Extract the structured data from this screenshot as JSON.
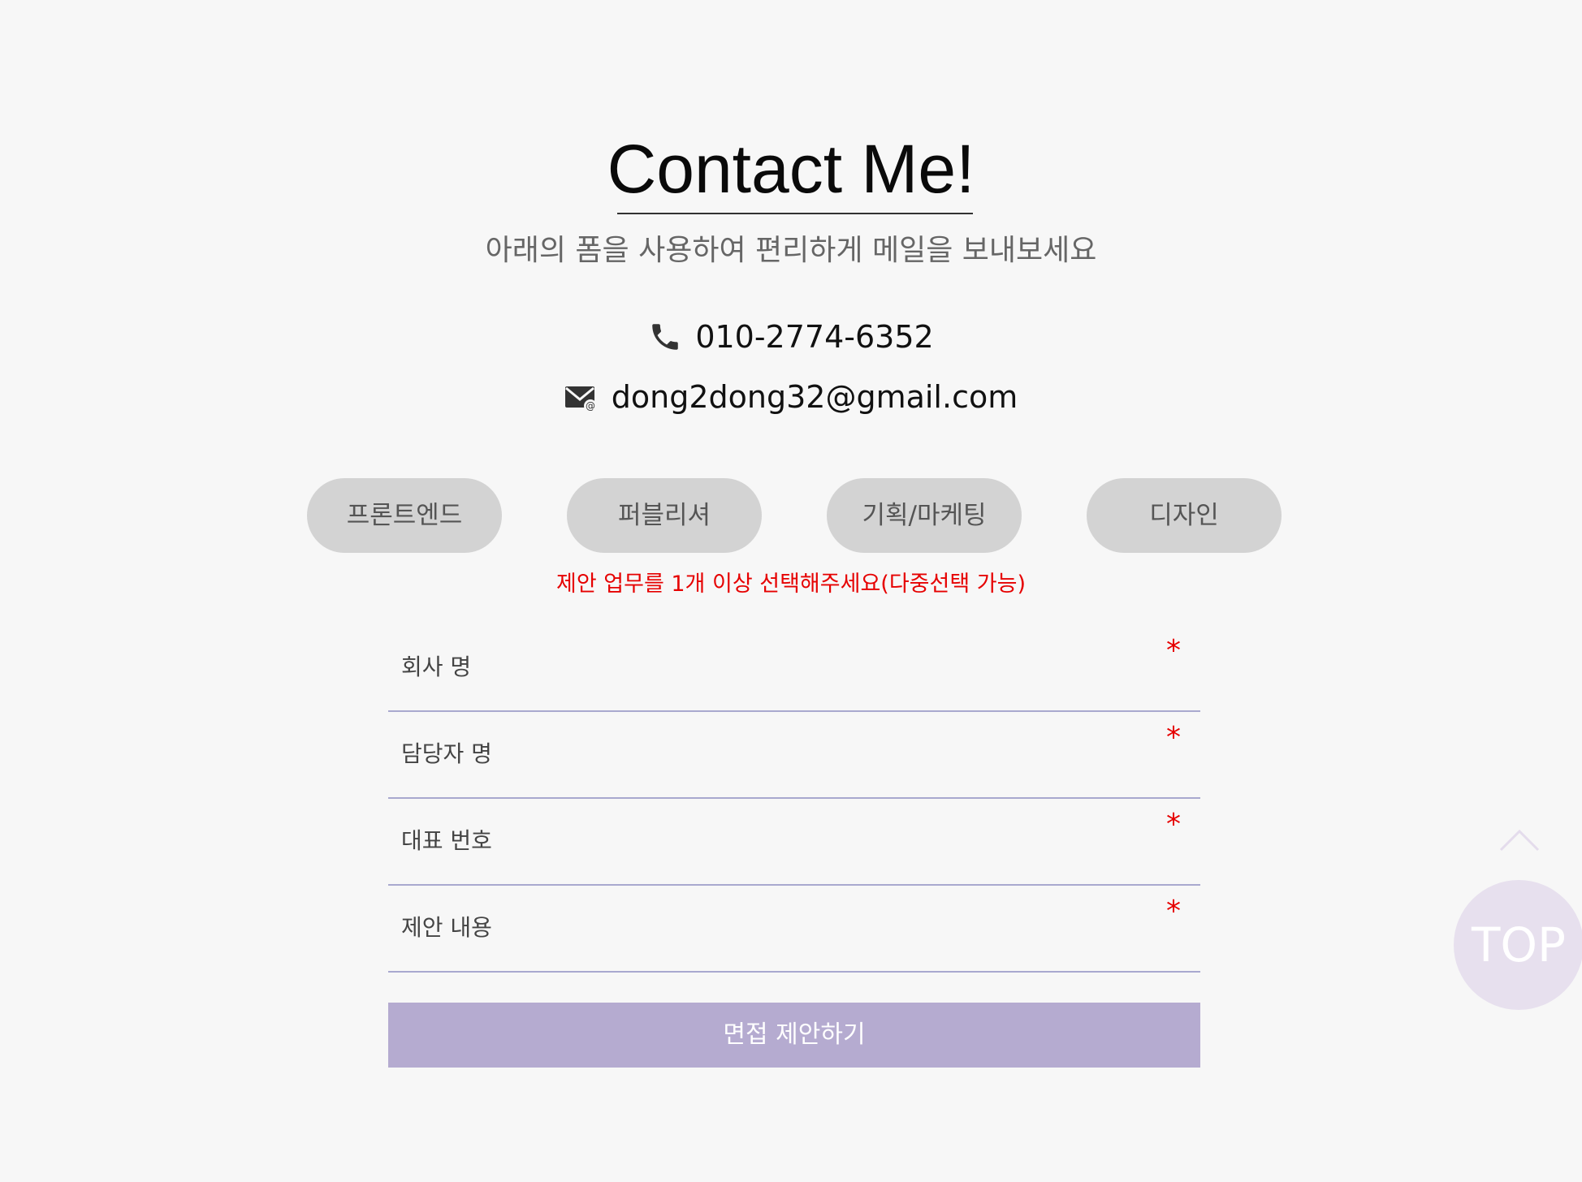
{
  "heading": {
    "title": "Contact Me!",
    "subtitle": "아래의 폼을 사용하여 편리하게 메일을 보내보세요"
  },
  "contact": {
    "phone_icon": "phone-icon",
    "phone": "010-2774-6352",
    "email_icon": "mail-icon",
    "email": "dong2dong32@gmail.com"
  },
  "categories": [
    {
      "label": "프론트엔드"
    },
    {
      "label": "퍼블리셔"
    },
    {
      "label": "기획/마케팅"
    },
    {
      "label": "디자인"
    }
  ],
  "warning": "제안 업무를 1개 이상 선택해주세요(다중선택 가능)",
  "form": {
    "required_mark": "*",
    "fields": [
      {
        "label": "회사 명"
      },
      {
        "label": "담당자 명"
      },
      {
        "label": "대표 번호"
      },
      {
        "label": "제안 내용"
      }
    ],
    "submit_label": "면접 제안하기"
  },
  "top_button": {
    "label": "TOP",
    "icon": "chevron-up-icon"
  },
  "colors": {
    "background": "#f7f7f7",
    "chip": "#d3d3d3",
    "warning": "#e60000",
    "underline": "#a9a9cf",
    "submit": "#b5abd0",
    "top_button": "#e7e0ee"
  }
}
